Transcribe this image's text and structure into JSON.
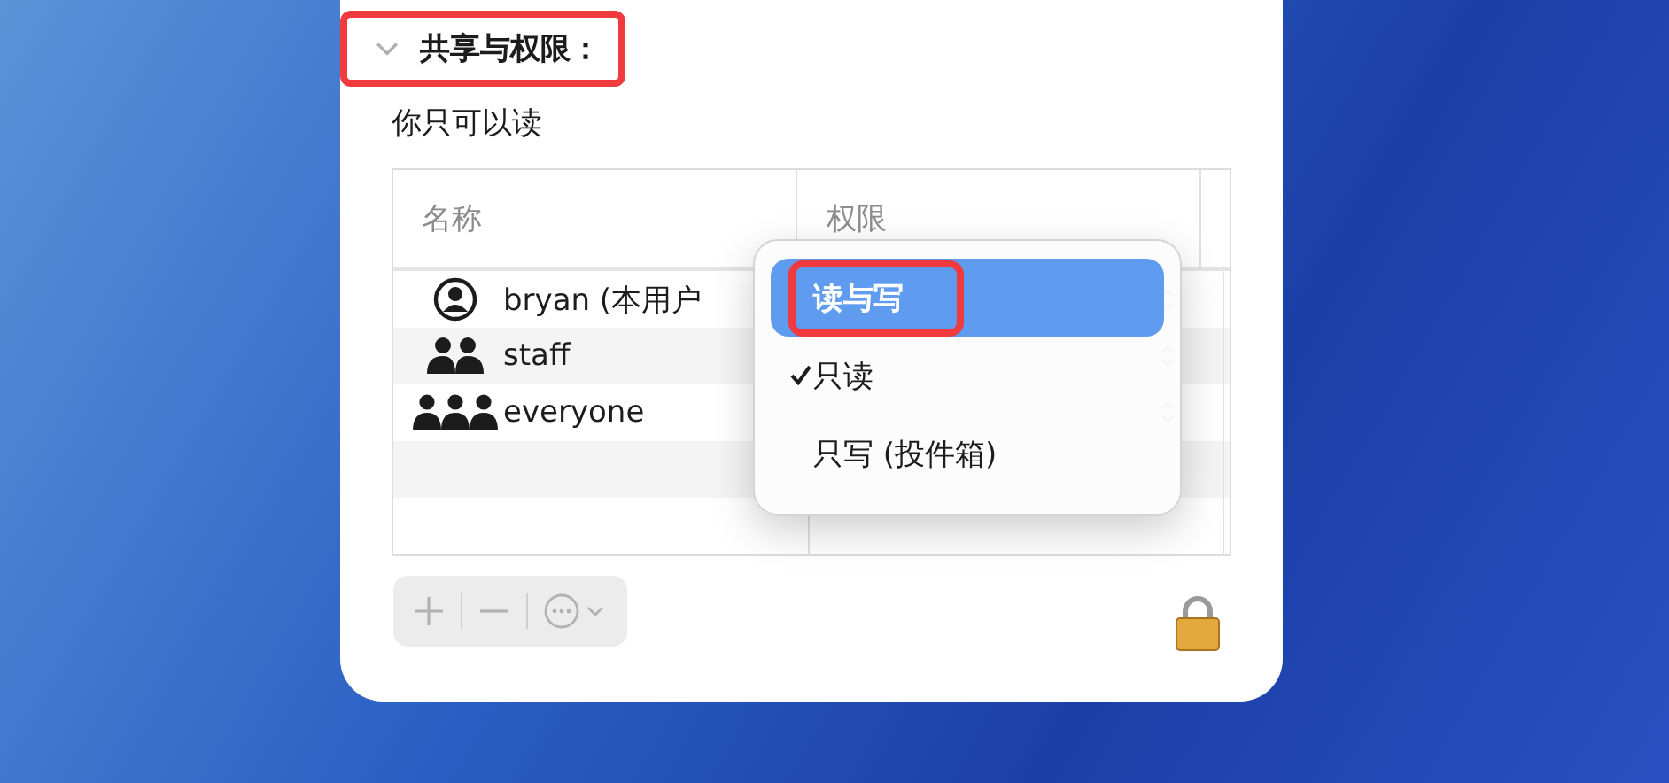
{
  "section": {
    "title": "共享与权限：",
    "expanded": true,
    "highlighted": true
  },
  "note": "你只可以读",
  "table": {
    "columns": [
      "名称",
      "权限"
    ],
    "rows": [
      {
        "kind": "user",
        "name": "bryan (本用户"
      },
      {
        "kind": "group",
        "name": "staff"
      },
      {
        "kind": "everyone",
        "name": "everyone"
      }
    ]
  },
  "menu": {
    "items": [
      {
        "label": "读与写",
        "selected": true,
        "checked": false,
        "highlighted": true
      },
      {
        "label": "只读",
        "selected": false,
        "checked": true,
        "highlighted": false
      },
      {
        "label": "只写 (投件箱)",
        "selected": false,
        "checked": false,
        "highlighted": false
      }
    ]
  },
  "toolbar": {
    "disabled": true
  },
  "locked": true
}
